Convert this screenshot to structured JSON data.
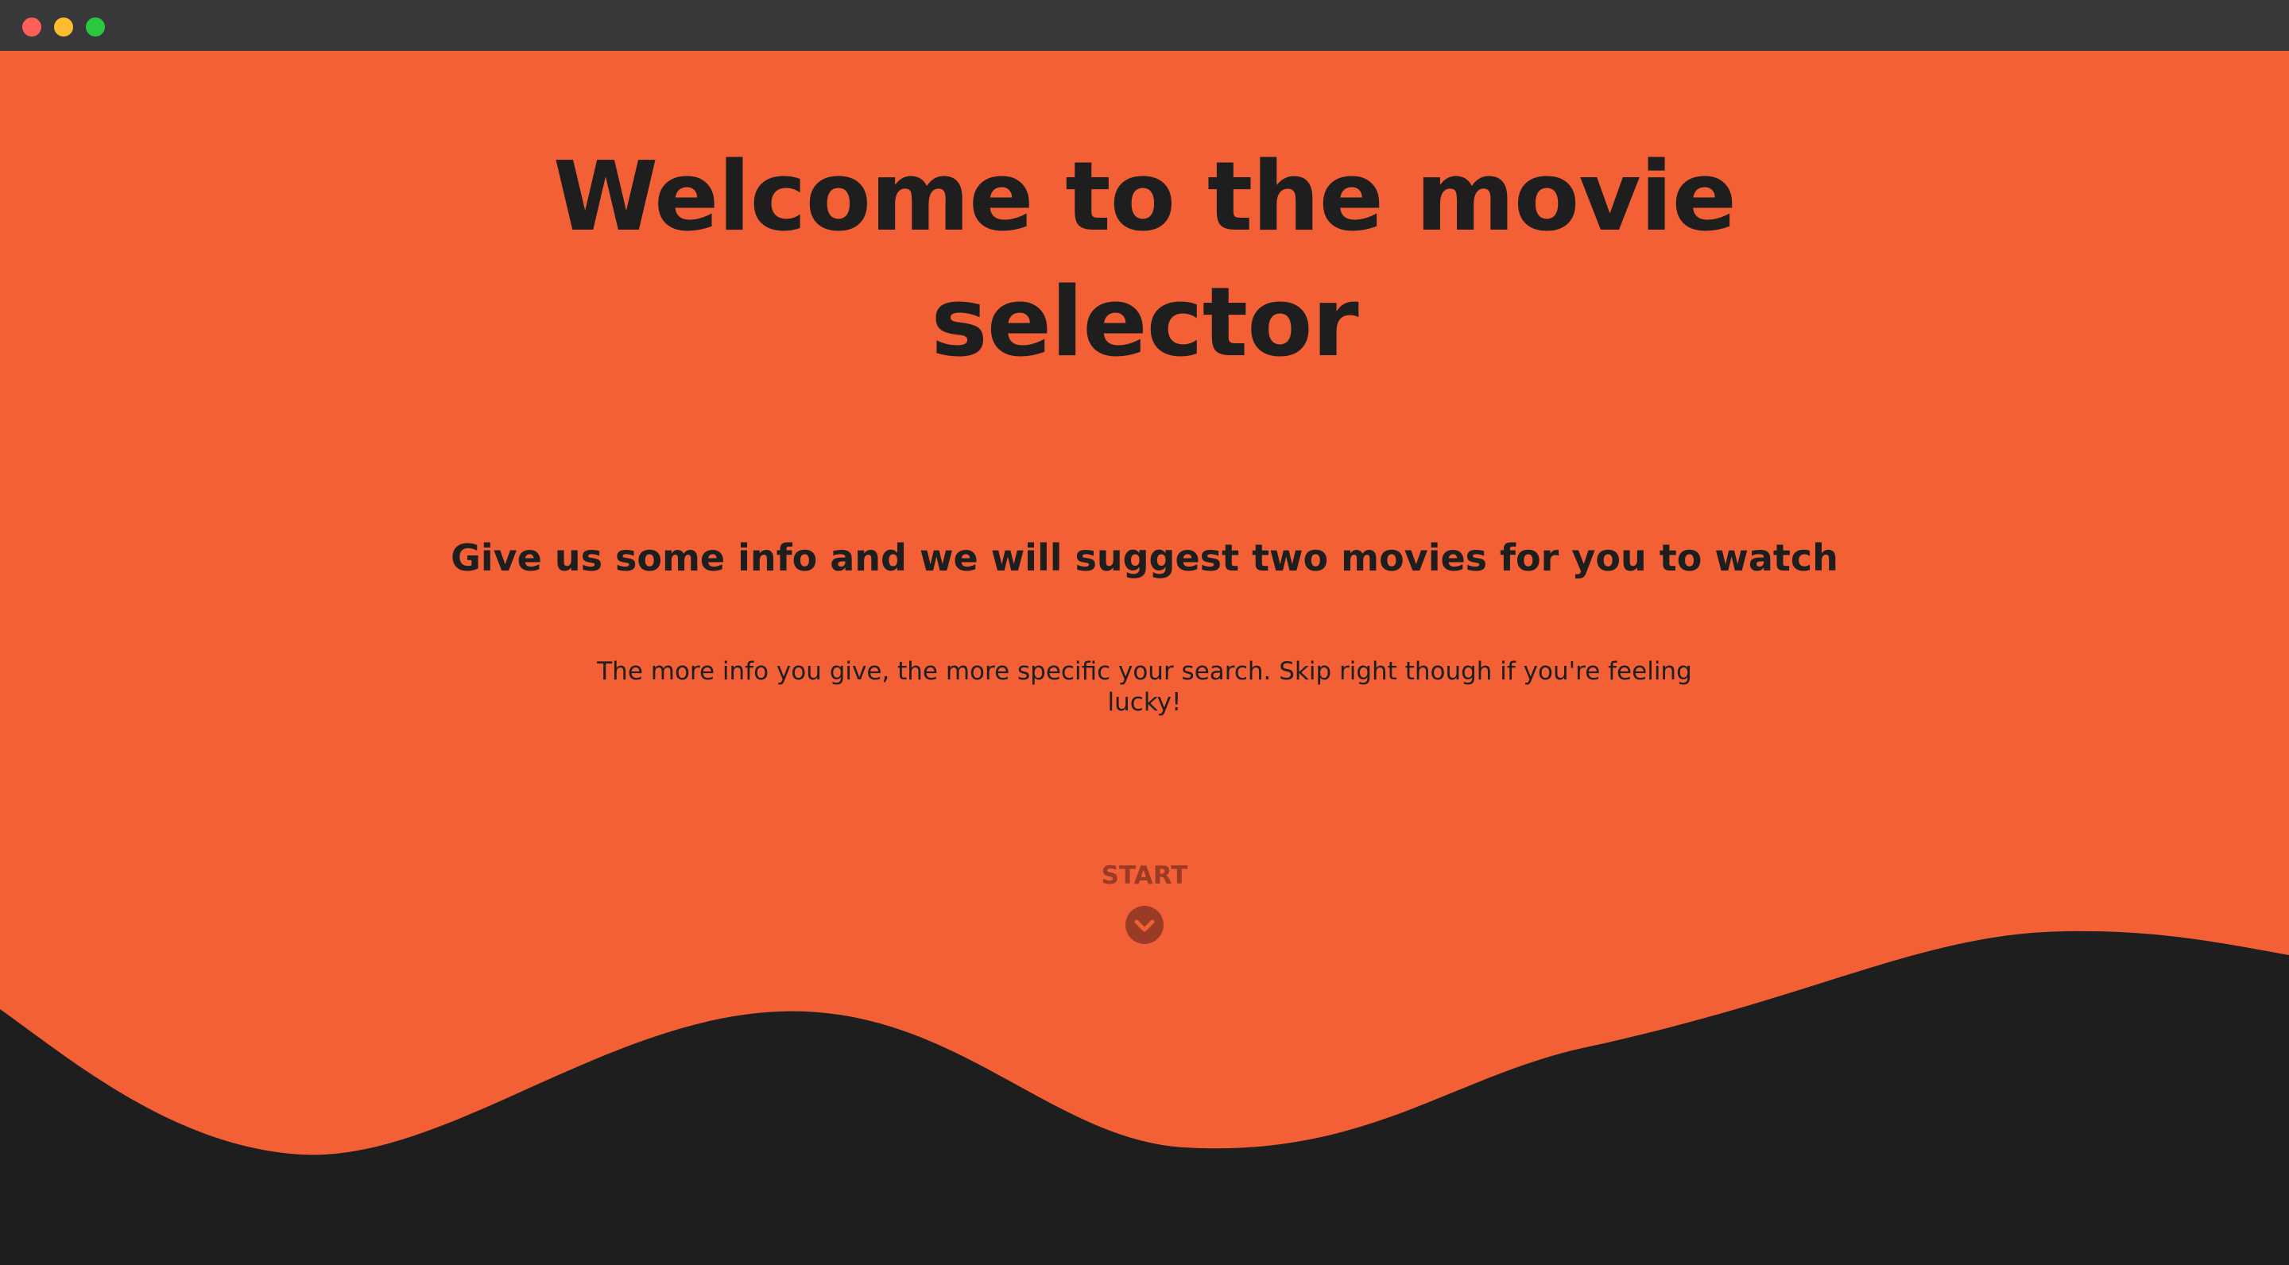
{
  "page": {
    "title": "Welcome to the movie selector",
    "subtitle": "Give us some info and we will suggest two movies for you to watch",
    "description": "The more info you give, the more specific your search. Skip right though if you're feeling lucky!",
    "start_label": "START"
  },
  "icons": {
    "start": "chevron-down-icon"
  },
  "colors": {
    "accent": "#f36036",
    "dark": "#1e1e1e",
    "button": "#9a3b25"
  }
}
